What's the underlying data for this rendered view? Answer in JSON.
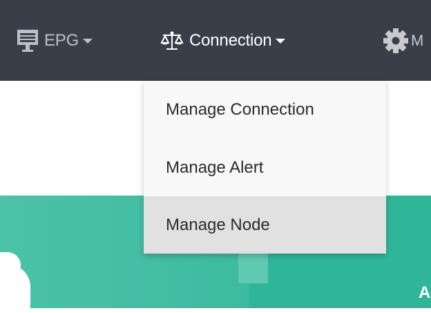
{
  "navbar": {
    "items": [
      {
        "label": "EPG",
        "icon": "monitor-icon"
      },
      {
        "label": "Connection",
        "icon": "balance-scale-icon"
      },
      {
        "label": "M",
        "icon": "gear-icon"
      }
    ]
  },
  "dropdown": {
    "items": [
      {
        "label": "Manage Connection"
      },
      {
        "label": "Manage Alert"
      },
      {
        "label": "Manage Node",
        "hovered": true
      }
    ]
  },
  "hero": {
    "letter": "A"
  },
  "colors": {
    "navbar": "#383f48",
    "hero": "#2fb698",
    "dropdown_bg": "#f8f8f8",
    "dropdown_hover": "#e1e1e1"
  }
}
